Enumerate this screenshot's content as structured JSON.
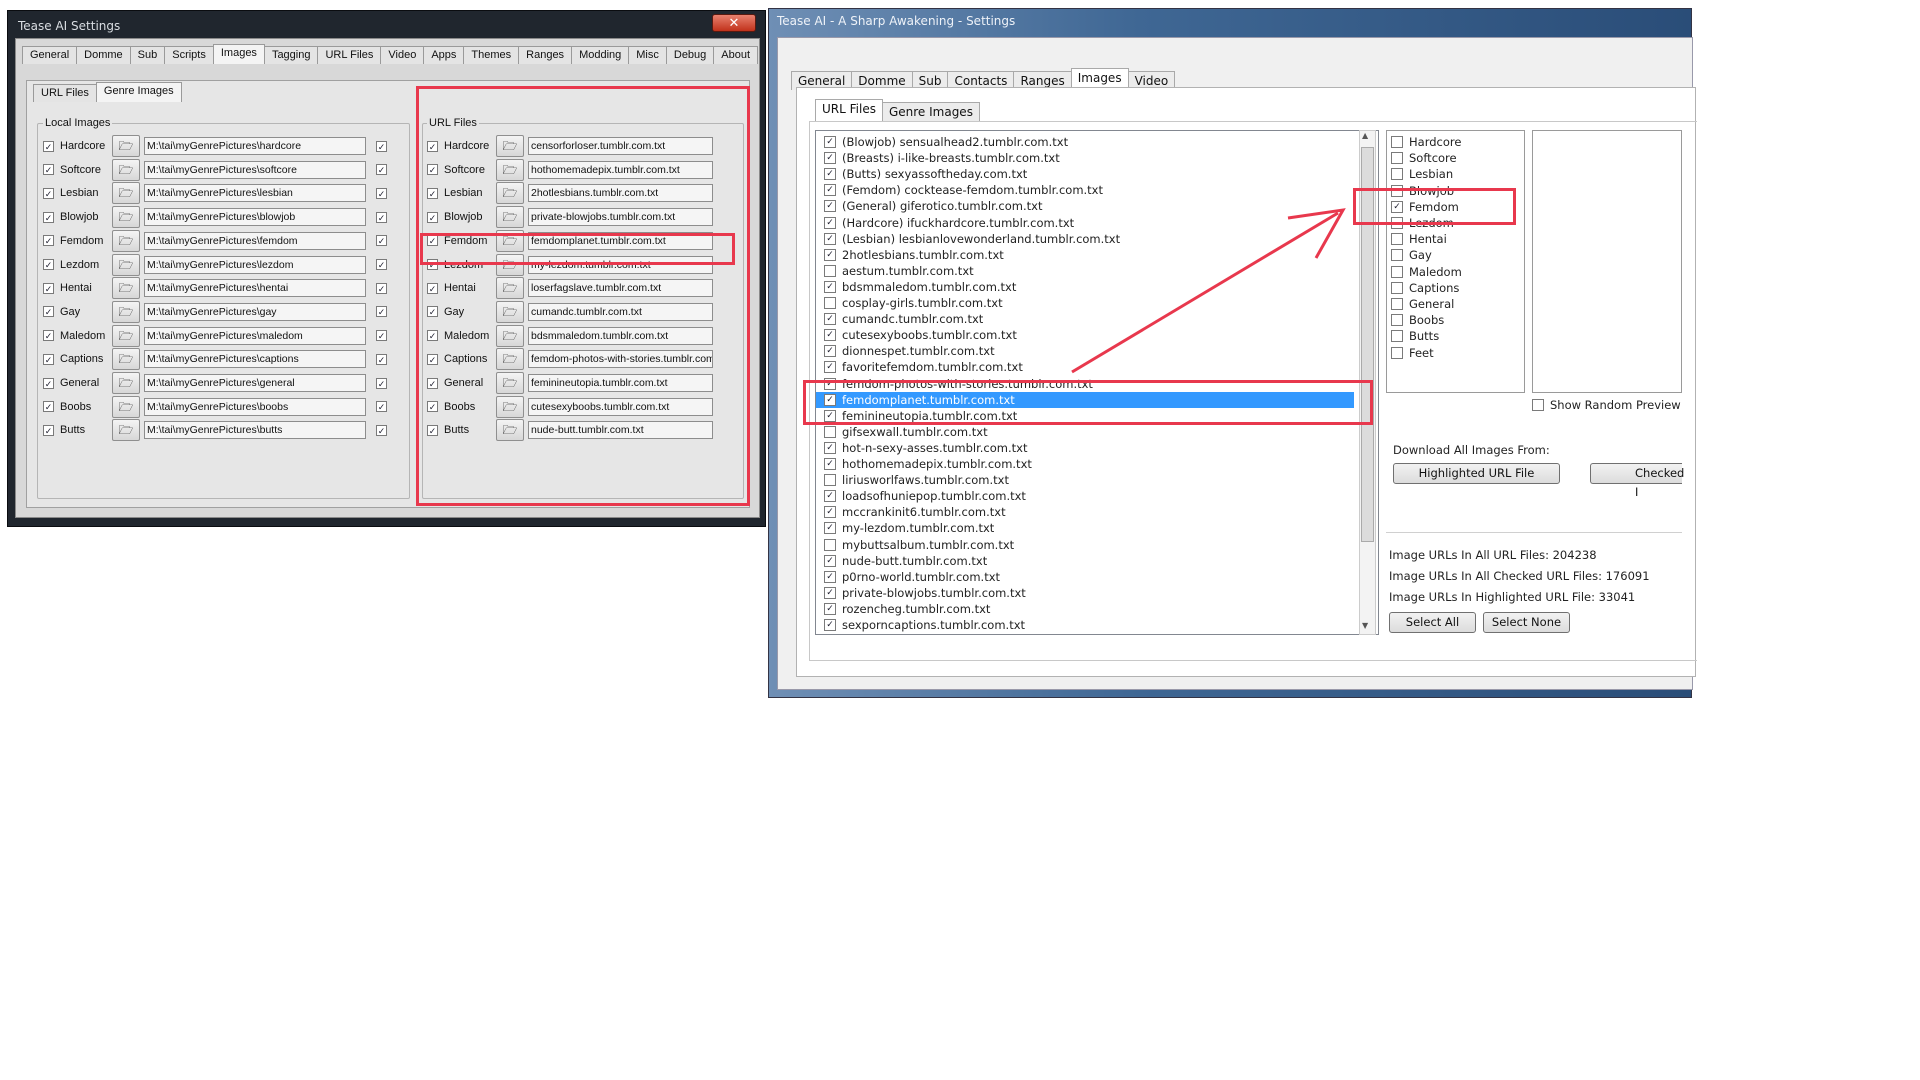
{
  "left_window": {
    "title": "Tease AI Settings",
    "close_label": "✕",
    "tabs": [
      "General",
      "Domme",
      "Sub",
      "Scripts",
      "Images",
      "Tagging",
      "URL Files",
      "Video",
      "Apps",
      "Themes",
      "Ranges",
      "Modding",
      "Misc",
      "Debug",
      "About"
    ],
    "active_tab": "Images",
    "subtabs": [
      "URL Files",
      "Genre Images"
    ],
    "active_subtab": "Genre Images",
    "local_group_label": "Local Images",
    "url_group_label": "URL Files",
    "local_rows": [
      {
        "label": "Hardcore",
        "path": "M:\\tai\\myGenrePictures\\hardcore"
      },
      {
        "label": "Softcore",
        "path": "M:\\tai\\myGenrePictures\\softcore"
      },
      {
        "label": "Lesbian",
        "path": "M:\\tai\\myGenrePictures\\lesbian"
      },
      {
        "label": "Blowjob",
        "path": "M:\\tai\\myGenrePictures\\blowjob"
      },
      {
        "label": "Femdom",
        "path": "M:\\tai\\myGenrePictures\\femdom"
      },
      {
        "label": "Lezdom",
        "path": "M:\\tai\\myGenrePictures\\lezdom"
      },
      {
        "label": "Hentai",
        "path": "M:\\tai\\myGenrePictures\\hentai"
      },
      {
        "label": "Gay",
        "path": "M:\\tai\\myGenrePictures\\gay"
      },
      {
        "label": "Maledom",
        "path": "M:\\tai\\myGenrePictures\\maledom"
      },
      {
        "label": "Captions",
        "path": "M:\\tai\\myGenrePictures\\captions"
      },
      {
        "label": "General",
        "path": "M:\\tai\\myGenrePictures\\general"
      },
      {
        "label": "Boobs",
        "path": "M:\\tai\\myGenrePictures\\boobs"
      },
      {
        "label": "Butts",
        "path": "M:\\tai\\myGenrePictures\\butts"
      }
    ],
    "url_rows": [
      {
        "label": "Hardcore",
        "path": "censorforloser.tumblr.com.txt"
      },
      {
        "label": "Softcore",
        "path": "hothomemadepix.tumblr.com.txt"
      },
      {
        "label": "Lesbian",
        "path": "2hotlesbians.tumblr.com.txt"
      },
      {
        "label": "Blowjob",
        "path": "private-blowjobs.tumblr.com.txt"
      },
      {
        "label": "Femdom",
        "path": "femdomplanet.tumblr.com.txt"
      },
      {
        "label": "Lezdom",
        "path": "my-lezdom.tumblr.com.txt"
      },
      {
        "label": "Hentai",
        "path": "loserfagslave.tumblr.com.txt"
      },
      {
        "label": "Gay",
        "path": "cumandc.tumblr.com.txt"
      },
      {
        "label": "Maledom",
        "path": "bdsmmaledom.tumblr.com.txt"
      },
      {
        "label": "Captions",
        "path": "femdom-photos-with-stories.tumblr.com"
      },
      {
        "label": "General",
        "path": "feminineutopia.tumblr.com.txt"
      },
      {
        "label": "Boobs",
        "path": "cutesexyboobs.tumblr.com.txt"
      },
      {
        "label": "Butts",
        "path": "nude-butt.tumblr.com.txt"
      }
    ]
  },
  "right_window": {
    "title": "Tease AI - A Sharp Awakening - Settings",
    "tabs": [
      "General",
      "Domme",
      "Sub",
      "Contacts",
      "Ranges",
      "Images",
      "Video"
    ],
    "active_tab": "Images",
    "subtabs": [
      "URL Files",
      "Genre Images"
    ],
    "active_subtab": "URL Files",
    "url_files": [
      {
        "name": "(Blowjob) sensualhead2.tumblr.com.txt",
        "checked": true
      },
      {
        "name": "(Breasts) i-like-breasts.tumblr.com.txt",
        "checked": true
      },
      {
        "name": "(Butts) sexyassoftheday.com.txt",
        "checked": true
      },
      {
        "name": "(Femdom) cocktease-femdom.tumblr.com.txt",
        "checked": true
      },
      {
        "name": "(General) giferotico.tumblr.com.txt",
        "checked": true
      },
      {
        "name": "(Hardcore) ifuckhardcore.tumblr.com.txt",
        "checked": true
      },
      {
        "name": "(Lesbian) lesbianlovewonderland.tumblr.com.txt",
        "checked": true
      },
      {
        "name": "2hotlesbians.tumblr.com.txt",
        "checked": true
      },
      {
        "name": "aestum.tumblr.com.txt",
        "checked": false
      },
      {
        "name": "bdsmmaledom.tumblr.com.txt",
        "checked": true
      },
      {
        "name": "cosplay-girls.tumblr.com.txt",
        "checked": false
      },
      {
        "name": "cumandc.tumblr.com.txt",
        "checked": true
      },
      {
        "name": "cutesexyboobs.tumblr.com.txt",
        "checked": true
      },
      {
        "name": "dionnespet.tumblr.com.txt",
        "checked": true
      },
      {
        "name": "favoritefemdom.tumblr.com.txt",
        "checked": true
      },
      {
        "name": "femdom-photos-with-stories.tumblr.com.txt",
        "checked": true
      },
      {
        "name": "femdomplanet.tumblr.com.txt",
        "checked": true
      },
      {
        "name": "feminineutopia.tumblr.com.txt",
        "checked": true
      },
      {
        "name": "gifsexwall.tumblr.com.txt",
        "checked": false
      },
      {
        "name": "hot-n-sexy-asses.tumblr.com.txt",
        "checked": true
      },
      {
        "name": "hothomemadepix.tumblr.com.txt",
        "checked": true
      },
      {
        "name": "liriusworlfaws.tumblr.com.txt",
        "checked": false
      },
      {
        "name": "loadsofhuniepop.tumblr.com.txt",
        "checked": true
      },
      {
        "name": "mccrankinit6.tumblr.com.txt",
        "checked": true
      },
      {
        "name": "my-lezdom.tumblr.com.txt",
        "checked": true
      },
      {
        "name": "mybuttsalbum.tumblr.com.txt",
        "checked": false
      },
      {
        "name": "nude-butt.tumblr.com.txt",
        "checked": true
      },
      {
        "name": "p0rno-world.tumblr.com.txt",
        "checked": true
      },
      {
        "name": "private-blowjobs.tumblr.com.txt",
        "checked": true
      },
      {
        "name": "rozencheg.tumblr.com.txt",
        "checked": true
      },
      {
        "name": "sexporncaptions.tumblr.com.txt",
        "checked": true
      }
    ],
    "selected_file": "femdomplanet.tumblr.com.txt",
    "genres": [
      {
        "name": "Hardcore",
        "checked": false
      },
      {
        "name": "Softcore",
        "checked": false
      },
      {
        "name": "Lesbian",
        "checked": false
      },
      {
        "name": "Blowjob",
        "checked": false
      },
      {
        "name": "Femdom",
        "checked": true
      },
      {
        "name": "Lezdom",
        "checked": false
      },
      {
        "name": "Hentai",
        "checked": false
      },
      {
        "name": "Gay",
        "checked": false
      },
      {
        "name": "Maledom",
        "checked": false
      },
      {
        "name": "Captions",
        "checked": false
      },
      {
        "name": "General",
        "checked": false
      },
      {
        "name": "Boobs",
        "checked": false
      },
      {
        "name": "Butts",
        "checked": false
      },
      {
        "name": "Feet",
        "checked": false
      }
    ],
    "show_random_preview_label": "Show Random Preview",
    "download_label": "Download All Images From:",
    "highlighted_btn": "Highlighted URL File",
    "checked_btn": "Checked I",
    "stat_all": "Image URLs In All URL Files: 204238",
    "stat_checked": "Image URLs In All Checked URL Files: 176091",
    "stat_highlighted": "Image URLs In Highlighted URL File: 33041",
    "select_all": "Select All",
    "select_none": "Select None"
  },
  "colors": {
    "highlight": "#e8384d",
    "selection": "#3399ff"
  }
}
